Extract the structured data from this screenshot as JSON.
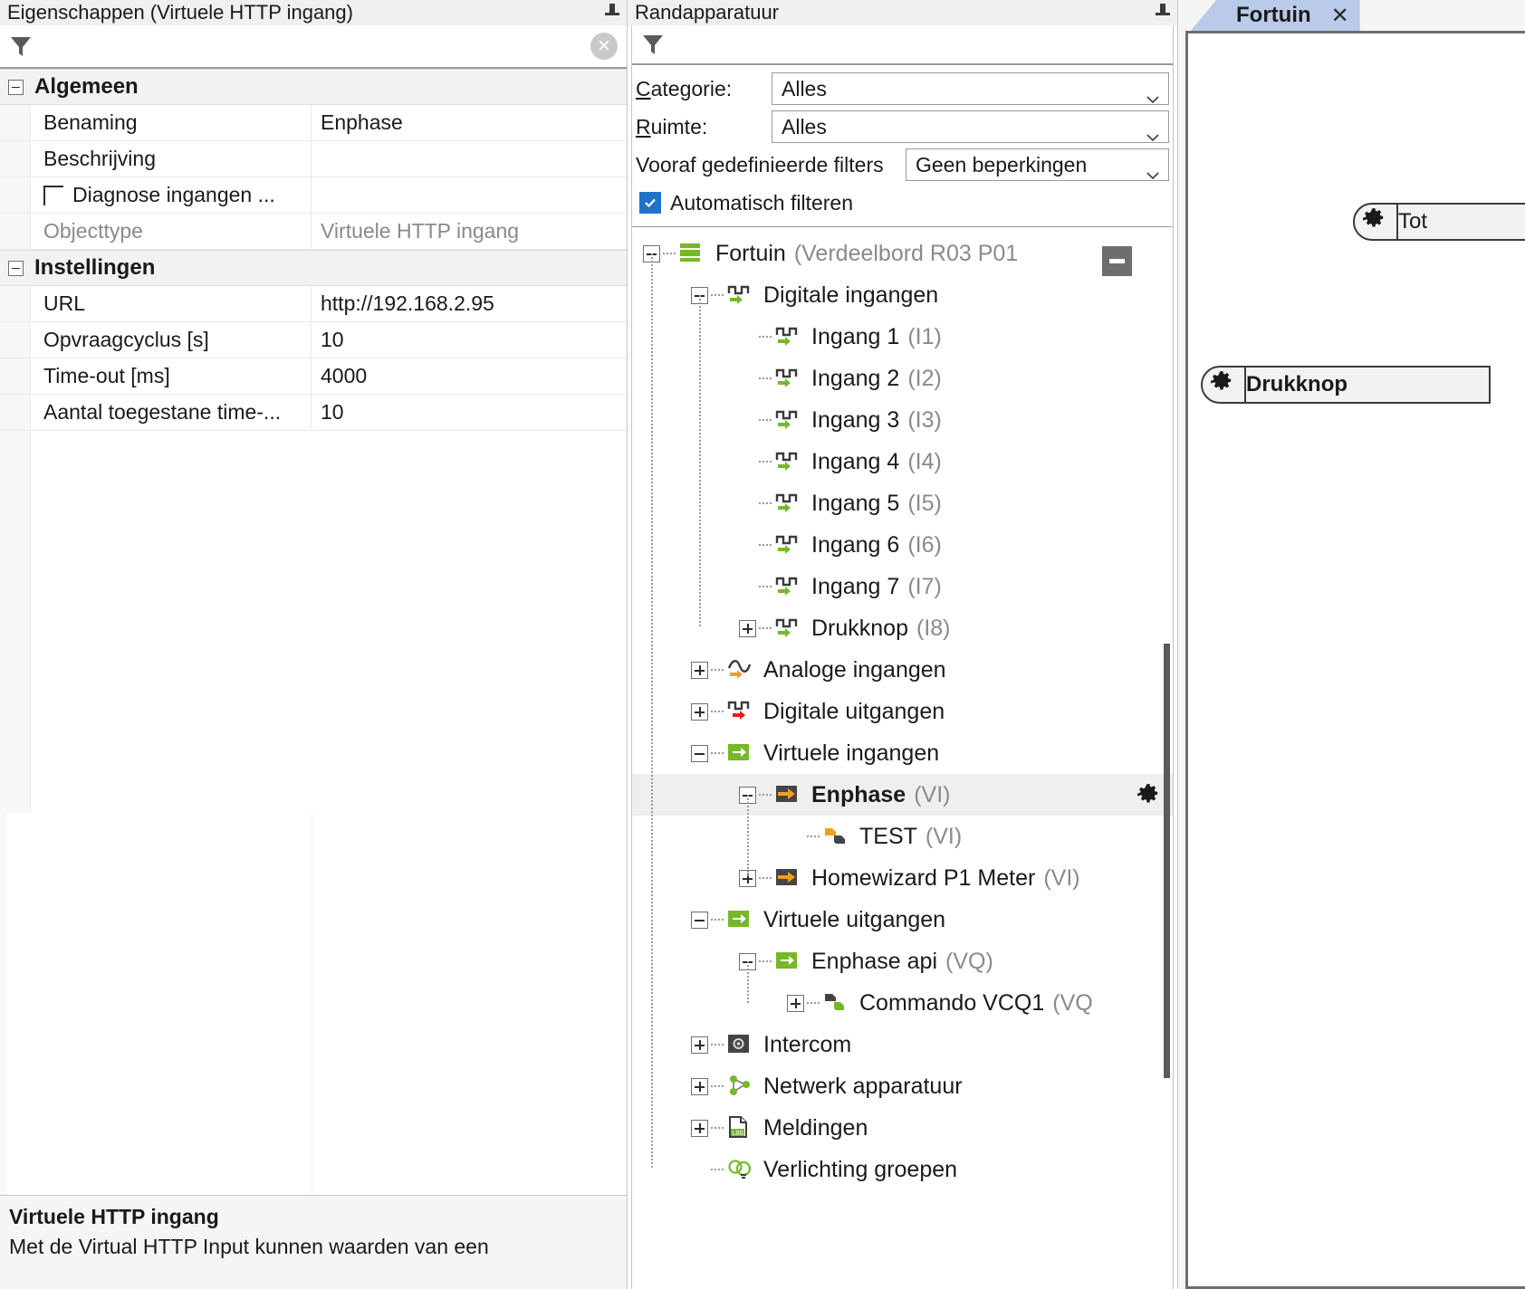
{
  "properties_panel": {
    "caption": "Eigenschappen (Virtuele HTTP ingang)",
    "pin_icon": "pin-icon",
    "filter": {
      "placeholder": "",
      "value": "",
      "funnel_icon": "funnel-icon",
      "clear_icon": "clear-circle-icon"
    },
    "categories": [
      {
        "label": "Algemeen",
        "expanded": true,
        "rows": [
          {
            "name": "Benaming",
            "value": "Enphase",
            "muted": false,
            "checkbox": false,
            "indent": false
          },
          {
            "name": "Beschrijving",
            "value": "",
            "muted": false,
            "checkbox": false,
            "indent": false
          },
          {
            "name": "Diagnose ingangen ...",
            "value": "",
            "muted": false,
            "checkbox": true,
            "indent": true
          },
          {
            "name": "Objecttype",
            "value": "Virtuele HTTP ingang",
            "muted": true,
            "checkbox": false,
            "indent": false
          }
        ]
      },
      {
        "label": "Instellingen",
        "expanded": true,
        "rows": [
          {
            "name": "URL",
            "value": "http://192.168.2.95",
            "muted": false,
            "checkbox": false,
            "indent": false
          },
          {
            "name": "Opvraagcyclus [s]",
            "value": "10",
            "muted": false,
            "checkbox": false,
            "indent": false
          },
          {
            "name": "Time-out [ms]",
            "value": "4000",
            "muted": false,
            "checkbox": false,
            "indent": false
          },
          {
            "name": "Aantal toegestane time-...",
            "value": "10",
            "muted": false,
            "checkbox": false,
            "indent": false
          }
        ]
      }
    ],
    "description": {
      "title": "Virtuele HTTP ingang",
      "text": "Met de Virtual HTTP Input kunnen waarden van een"
    }
  },
  "peripherals_panel": {
    "caption": "Randapparatuur",
    "pin_icon": "pin-icon",
    "filter": {
      "placeholder": "",
      "value": "",
      "funnel_icon": "funnel-icon",
      "clear_icon": "clear-circle-icon"
    },
    "form": {
      "category_label": "Categorie:",
      "category_accel": "C",
      "category_value": "Alles",
      "room_label": "Ruimte:",
      "room_accel": "R",
      "room_value": "Alles",
      "predefined_label": "Vooraf gedefinieerde filters",
      "predefined_value": "Geen beperkingen",
      "auto_filter_label": "Automatisch filteren",
      "auto_filter_checked": true
    },
    "tree": [
      {
        "label": "Fortuin",
        "suffix": "(Verdeelbord R03 P01",
        "icon": "controller-icon",
        "state": "minus",
        "depth": 0,
        "selected": false,
        "bold": false
      },
      {
        "label": "Digitale ingangen",
        "suffix": "",
        "icon": "digital-input-icon",
        "state": "minus",
        "depth": 1,
        "selected": false,
        "bold": false
      },
      {
        "label": "Ingang 1",
        "suffix": "(I1)",
        "icon": "digital-input-icon",
        "state": "leaf",
        "depth": 2,
        "selected": false,
        "bold": false
      },
      {
        "label": "Ingang 2",
        "suffix": "(I2)",
        "icon": "digital-input-icon",
        "state": "leaf",
        "depth": 2,
        "selected": false,
        "bold": false
      },
      {
        "label": "Ingang 3",
        "suffix": "(I3)",
        "icon": "digital-input-icon",
        "state": "leaf",
        "depth": 2,
        "selected": false,
        "bold": false
      },
      {
        "label": "Ingang 4",
        "suffix": "(I4)",
        "icon": "digital-input-icon",
        "state": "leaf",
        "depth": 2,
        "selected": false,
        "bold": false
      },
      {
        "label": "Ingang 5",
        "suffix": "(I5)",
        "icon": "digital-input-icon",
        "state": "leaf",
        "depth": 2,
        "selected": false,
        "bold": false
      },
      {
        "label": "Ingang 6",
        "suffix": "(I6)",
        "icon": "digital-input-icon",
        "state": "leaf",
        "depth": 2,
        "selected": false,
        "bold": false
      },
      {
        "label": "Ingang 7",
        "suffix": "(I7)",
        "icon": "digital-input-icon",
        "state": "leaf",
        "depth": 2,
        "selected": false,
        "bold": false
      },
      {
        "label": "Drukknop",
        "suffix": "(I8)",
        "icon": "digital-input-icon",
        "state": "plus",
        "depth": 2,
        "selected": false,
        "bold": false
      },
      {
        "label": "Analoge ingangen",
        "suffix": "",
        "icon": "analog-input-icon",
        "state": "plus",
        "depth": 1,
        "selected": false,
        "bold": false
      },
      {
        "label": "Digitale uitgangen",
        "suffix": "",
        "icon": "digital-output-icon",
        "state": "plus",
        "depth": 1,
        "selected": false,
        "bold": false
      },
      {
        "label": "Virtuele ingangen",
        "suffix": "",
        "icon": "virtual-input-icon",
        "state": "minus",
        "depth": 1,
        "selected": false,
        "bold": false
      },
      {
        "label": "Enphase",
        "suffix": "(VI)",
        "icon": "virtual-http-input-icon",
        "state": "minus",
        "depth": 2,
        "selected": true,
        "bold": true,
        "gear": true
      },
      {
        "label": "TEST",
        "suffix": "(VI)",
        "icon": "virtual-input-child-icon",
        "state": "leaf",
        "depth": 3,
        "selected": false,
        "bold": false
      },
      {
        "label": "Homewizard P1 Meter",
        "suffix": "(VI)",
        "icon": "virtual-http-input-icon",
        "state": "plus",
        "depth": 2,
        "selected": false,
        "bold": false
      },
      {
        "label": "Virtuele uitgangen",
        "suffix": "",
        "icon": "virtual-output-icon",
        "state": "minus",
        "depth": 1,
        "selected": false,
        "bold": false
      },
      {
        "label": "Enphase api",
        "suffix": "(VQ)",
        "icon": "virtual-output-icon",
        "state": "minus",
        "depth": 2,
        "selected": false,
        "bold": false
      },
      {
        "label": "Commando VCQ1",
        "suffix": "(VQ",
        "icon": "command-icon",
        "state": "plus",
        "depth": 3,
        "selected": false,
        "bold": false
      },
      {
        "label": "Intercom",
        "suffix": "",
        "icon": "intercom-icon",
        "state": "plus",
        "depth": 1,
        "selected": false,
        "bold": false
      },
      {
        "label": "Netwerk apparatuur",
        "suffix": "",
        "icon": "network-icon",
        "state": "plus",
        "depth": 1,
        "selected": false,
        "bold": false
      },
      {
        "label": "Meldingen",
        "suffix": "",
        "icon": "log-icon",
        "state": "plus",
        "depth": 1,
        "selected": false,
        "bold": false
      },
      {
        "label": "Verlichting groepen",
        "suffix": "",
        "icon": "lighting-group-icon",
        "state": "leaf",
        "depth": 1,
        "selected": false,
        "bold": false
      }
    ]
  },
  "canvas_panel": {
    "tab": {
      "label": "Fortuin",
      "close": "✕"
    },
    "blocks": [
      {
        "label": "Tot",
        "gear_icon": "gear-icon",
        "bold": false
      },
      {
        "label": "Drukknop",
        "gear_icon": "gear-icon",
        "bold": true
      }
    ]
  },
  "colors": {
    "green": "#76B82A",
    "orange": "#F0A024",
    "red": "#E32119",
    "dark": "#444444",
    "selection": "#EFEFEF",
    "tab_active": "#B9CBE8",
    "checkbox_blue": "#1E73C8"
  }
}
